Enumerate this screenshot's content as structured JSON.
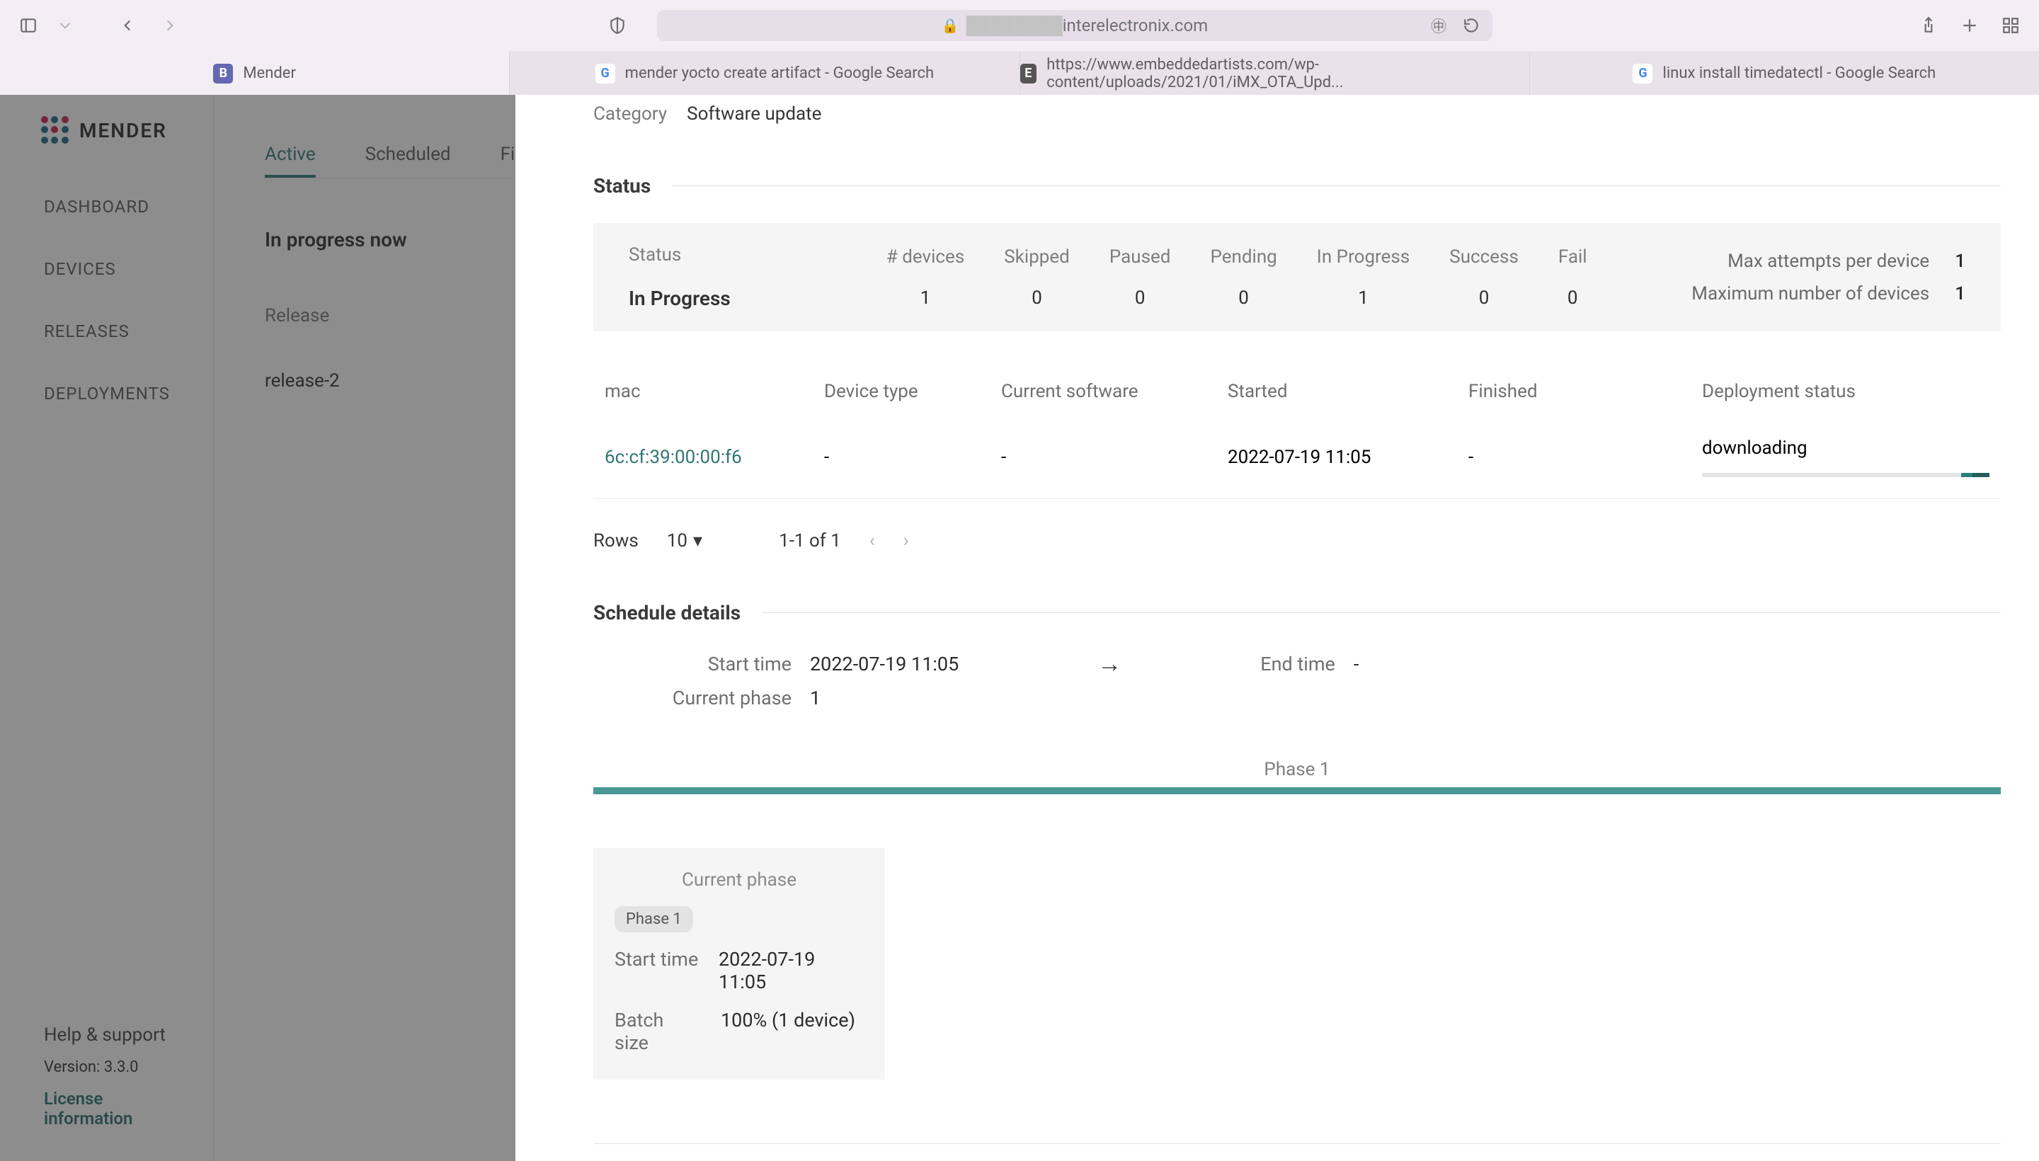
{
  "browser": {
    "url_domain": "interelectronix.com",
    "tabs": [
      {
        "label": "Mender",
        "icon": "B",
        "iconClass": "fb-b"
      },
      {
        "label": "mender yocto create artifact - Google Search",
        "icon": "G",
        "iconClass": "fb-g"
      },
      {
        "label": "https://www.embeddedartists.com/wp-content/uploads/2021/01/iMX_OTA_Upd...",
        "icon": "E",
        "iconClass": "fb-e"
      },
      {
        "label": "linux install timedatectl - Google Search",
        "icon": "G",
        "iconClass": "fb-g"
      }
    ]
  },
  "menderSidebar": {
    "brand": "MENDER",
    "nav": [
      "DASHBOARD",
      "DEVICES",
      "RELEASES",
      "DEPLOYMENTS"
    ],
    "help": "Help & support",
    "version": "Version: 3.3.0",
    "license": "License information"
  },
  "bg": {
    "tabs": [
      "Active",
      "Scheduled",
      "Finish"
    ],
    "caption": "In progress now",
    "releaseLabel": "Release",
    "releaseValue": "release-2"
  },
  "modal": {
    "categoryLabel": "Category",
    "categoryValue": "Software update",
    "statusTitle": "Status",
    "sb": {
      "statusLabel": "Status",
      "statusValue": "In Progress",
      "cols": [
        {
          "h": "# devices",
          "v": "1"
        },
        {
          "h": "Skipped",
          "v": "0"
        },
        {
          "h": "Paused",
          "v": "0"
        },
        {
          "h": "Pending",
          "v": "0"
        },
        {
          "h": "In Progress",
          "v": "1"
        },
        {
          "h": "Success",
          "v": "0"
        },
        {
          "h": "Fail",
          "v": "0"
        }
      ],
      "right": [
        {
          "l": "Max attempts per device",
          "v": "1"
        },
        {
          "l": "Maximum number of devices",
          "v": "1"
        }
      ]
    },
    "table": {
      "headers": [
        "mac",
        "Device type",
        "Current software",
        "Started",
        "Finished",
        "Deployment status"
      ],
      "row": {
        "mac": "6c:cf:39:00:00:f6",
        "devtype": "-",
        "cursw": "-",
        "started": "2022-07-19 11:05",
        "finished": "-",
        "depstatus": "downloading"
      }
    },
    "pager": {
      "rows": "Rows",
      "val": "10",
      "range": "1-1 of 1"
    },
    "schedTitle": "Schedule details",
    "sched": {
      "startLabel": "Start time",
      "startVal": "2022-07-19 11:05",
      "endLabel": "End time",
      "endVal": "-",
      "phaseLabel": "Current phase",
      "phaseVal": "1"
    },
    "phaseBarLabel": "Phase 1",
    "phaseCard": {
      "title": "Current phase",
      "badge": "Phase 1",
      "startL": "Start time",
      "startV": "2022-07-19 11:05",
      "batchL": "Batch size",
      "batchV": "100% (1 device)"
    }
  }
}
